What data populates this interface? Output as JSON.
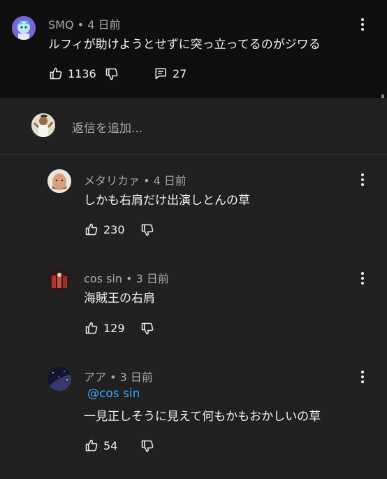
{
  "top_comment": {
    "author": "SMQ",
    "time": "4 日前",
    "text": "ルフィが助けようとせずに突っ立ってるのがジワる",
    "likes": "1136",
    "replies_count": "27"
  },
  "reply_input": {
    "placeholder": "返信を追加..."
  },
  "replies": [
    {
      "author": "メタリカァ",
      "time": "4 日前",
      "text": "しかも右肩だけ出演しとんの草",
      "likes": "230"
    },
    {
      "author": "cos sin",
      "time": "3 日前",
      "text": "海賊王の右肩",
      "likes": "129"
    },
    {
      "author": "アア",
      "time": "3 日前",
      "mention": "@cos sin",
      "text": "一見正しそうに見えて何もかもおかしいの草",
      "likes": "54"
    }
  ],
  "meta_separator": "•",
  "colors": {
    "background": "#212121",
    "parent_background": "#0f0f0f",
    "mention": "#3ea6ff"
  }
}
